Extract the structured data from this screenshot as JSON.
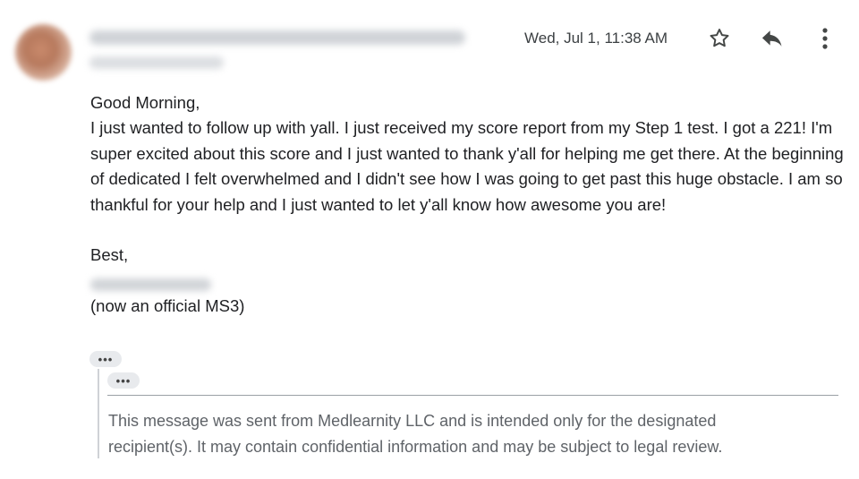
{
  "header": {
    "date": "Wed, Jul 1, 11:38 AM",
    "icons": [
      "star-icon",
      "reply-icon",
      "more-vert-icon"
    ]
  },
  "message": {
    "greeting": "Good Morning,",
    "paragraph": "I just wanted to follow up with yall. I just received my score report from my Step 1 test. I got a 221! I'm super excited about this score and I just wanted to thank y'all for helping me get there. At the beginning of dedicated I felt overwhelmed and I didn't see how I was going to get past this huge obstacle. I am so thankful for your help and I just wanted to let y'all know how awesome you are!",
    "closing": "Best,",
    "note": "(now an official MS3)"
  },
  "quoted": {
    "dots": "•••",
    "disclaimer": "This message was sent from Medlearnity LLC and is intended only for the designated recipient(s). It may contain confidential information and may be subject to legal review."
  },
  "colors": {
    "text": "#202124",
    "secondary": "#5f6368",
    "icon": "#444746"
  }
}
